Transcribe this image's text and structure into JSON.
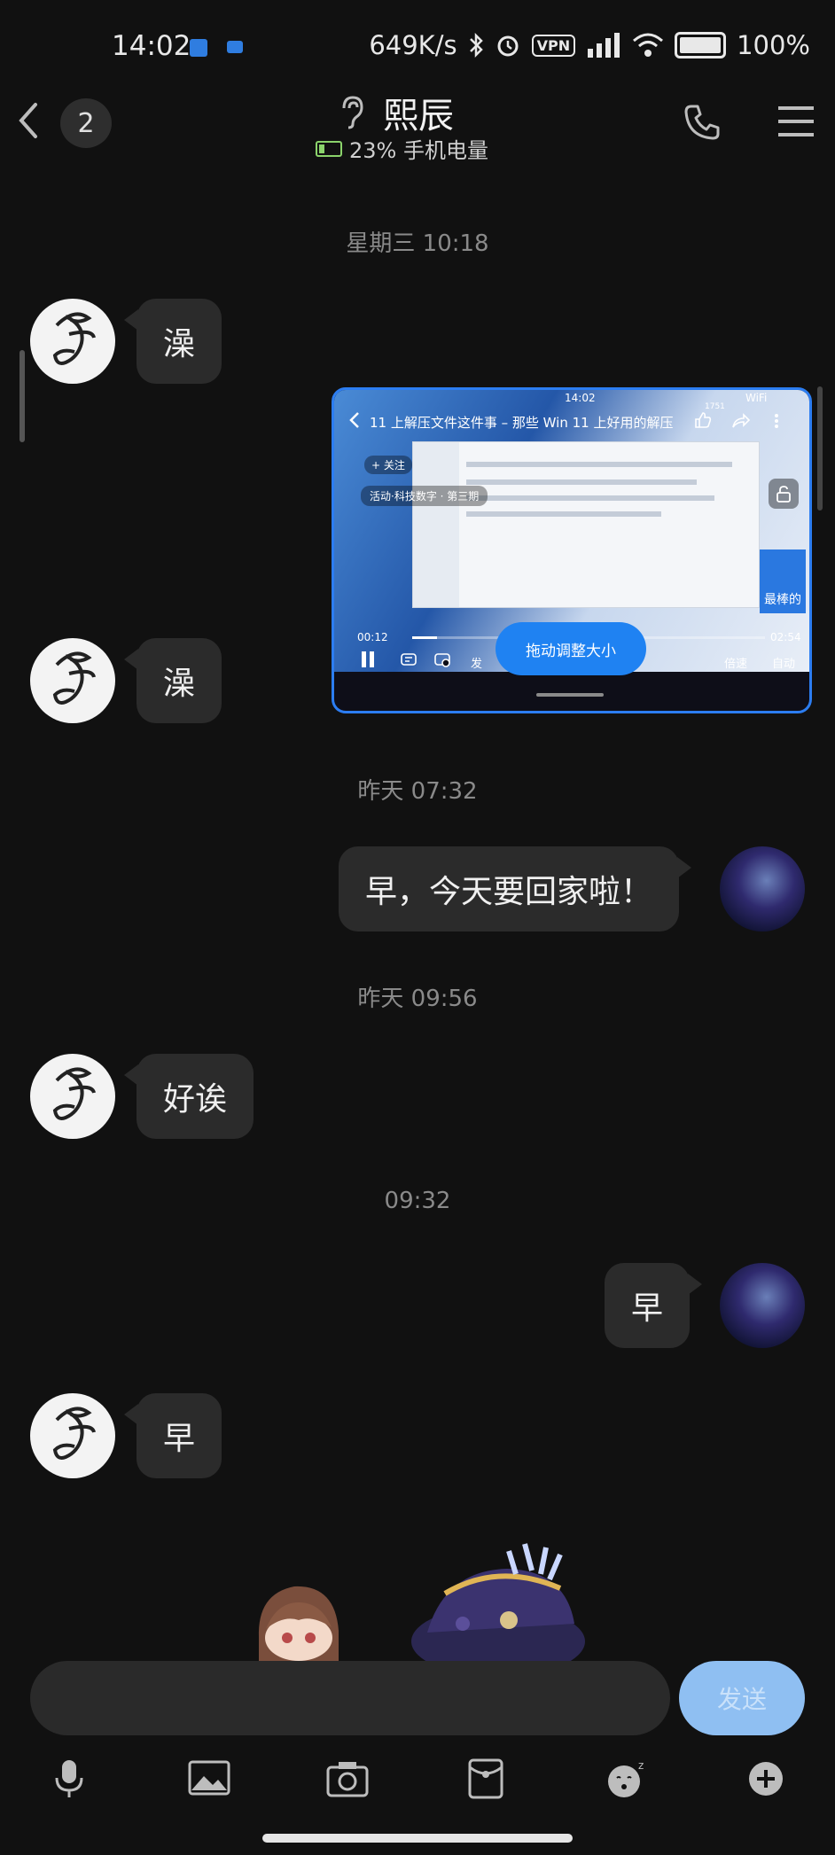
{
  "status_bar": {
    "time": "14:02",
    "net_speed": "649K/s",
    "vpn_label": "VPN",
    "signal_sub": "6",
    "battery": "100%"
  },
  "header": {
    "back_badge": "2",
    "contact_name": "熙辰",
    "device_battery": "23% 手机电量"
  },
  "messages": {
    "ts1": "星期三 10:18",
    "m1": "澡",
    "m2": "澡",
    "ts2": "昨天 07:32",
    "m3": "早，今天要回家啦！",
    "ts3": "昨天 09:56",
    "m4": "好诶",
    "ts4": "09:32",
    "m5": "早",
    "m6": "早"
  },
  "floating_video": {
    "status_time": "14:02",
    "status_wifi": "WiFi",
    "title": "11 上解压文件这件事 – 那些 Win 11 上好用的解压",
    "like_count": "1751",
    "follow_label": "+ 关注",
    "event_label": "活动·科技数字 · 第三期",
    "current_time": "00:12",
    "duration": "02:54",
    "progress": 0.07,
    "resize_hint": "拖动调整大小",
    "speed_label": "倍速",
    "auto_label": "自动",
    "side_banner": "最棒的",
    "send_label": "发"
  },
  "composer": {
    "placeholder": "",
    "send_label": "发送"
  },
  "toolbar_icons": [
    "mic-icon",
    "image-icon",
    "camera-icon",
    "red-packet-icon",
    "emoji-icon",
    "plus-icon"
  ],
  "colors": {
    "background": "#111111",
    "bubble": "#2b2b2b",
    "accent": "#1f82f2",
    "send_disabled": "#8fbff2"
  }
}
